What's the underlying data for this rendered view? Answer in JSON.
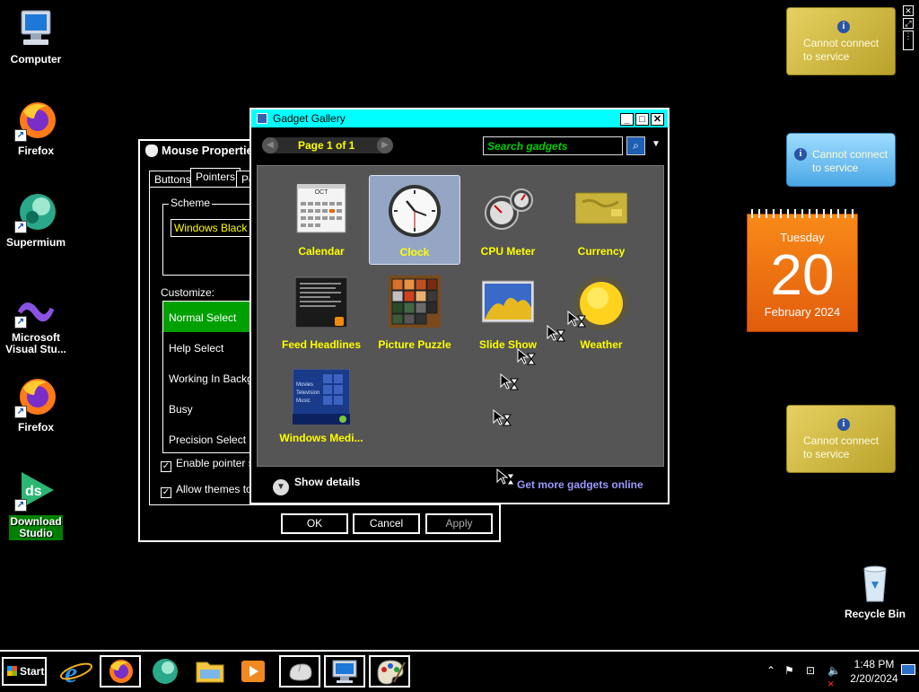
{
  "desktop": {
    "icons": [
      {
        "label": "Computer"
      },
      {
        "label": "Firefox"
      },
      {
        "label": "Supermium"
      },
      {
        "label": "Microsoft Visual Stu..."
      },
      {
        "label": "Firefox"
      },
      {
        "label": "Download Studio"
      },
      {
        "label": "Recycle Bin"
      }
    ]
  },
  "gadgets": {
    "currency_top": {
      "message": "Cannot connect to service",
      "info": "i"
    },
    "weather": {
      "message": "Cannot connect to service",
      "info": "i"
    },
    "calendar": {
      "weekday": "Tuesday",
      "day": "20",
      "month_year": "February 2024"
    },
    "currency_bottom": {
      "message": "Cannot connect to service",
      "info": "i"
    }
  },
  "mouse_properties": {
    "title": "Mouse Properties",
    "tabs": [
      "Buttons",
      "Pointers",
      "Po"
    ],
    "scheme_label": "Scheme",
    "scheme_value": "Windows Black (sy",
    "customize_label": "Customize:",
    "cursor_list": [
      "Normal Select",
      "Help Select",
      "Working In Backgro",
      "Busy",
      "Precision Select"
    ],
    "checkbox_shadow": "Enable pointer sh",
    "checkbox_themes": "Allow themes to c",
    "ok": "OK",
    "cancel": "Cancel",
    "apply": "Apply"
  },
  "gadget_gallery": {
    "title": "Gadget Gallery",
    "page": "Page 1 of 1",
    "search_placeholder": "Search gadgets",
    "gadgets": [
      "Calendar",
      "Clock",
      "CPU Meter",
      "Currency",
      "Feed Headlines",
      "Picture Puzzle",
      "Slide Show",
      "Weather",
      "Windows Medi..."
    ],
    "calendar_thumb_month": "OCT",
    "media_thumb_items": [
      "Movies",
      "Television",
      "Music"
    ],
    "show_details": "Show details",
    "get_more": "Get more gadgets online"
  },
  "taskbar": {
    "start": "Start",
    "time": "1:48 PM",
    "date": "2/20/2024"
  },
  "colors": {
    "title_active": "#00ffff",
    "highlight": "#00a000",
    "gallery_text": "#ffff00",
    "link": "#9a9aff"
  }
}
